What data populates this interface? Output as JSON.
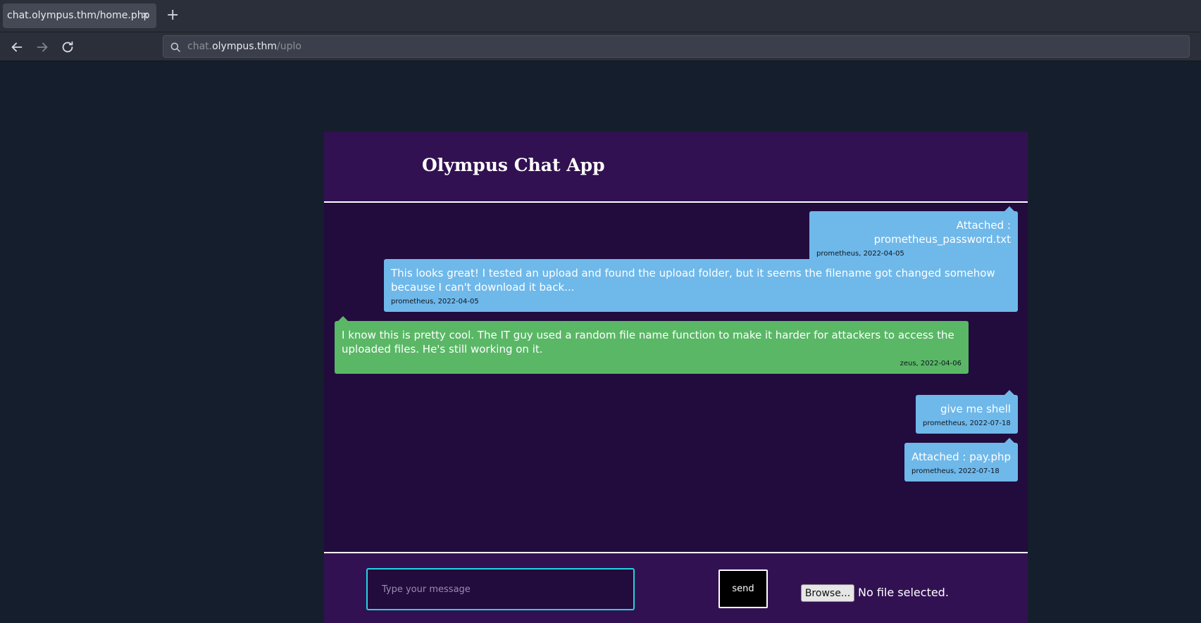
{
  "browser": {
    "tab_title": "chat.olympus.thm/home.php",
    "tab_close": "×",
    "new_tab": "+",
    "url_scheme_part": "chat.",
    "url_host": "olympus.thm",
    "url_path": "/uplo"
  },
  "app": {
    "title": "Olympus Chat App"
  },
  "messages": [
    {
      "text": "Attached : prometheus_password.txt",
      "meta": "prometheus, 2022-04-05",
      "side": "right",
      "color": "#6fb8ea"
    },
    {
      "text": "This looks great! I tested an upload and found the upload folder, but it seems the filename got changed somehow because I can't download it back...",
      "meta": "prometheus, 2022-04-05",
      "side": "right",
      "color": "#6fb8ea"
    },
    {
      "text": "I know this is pretty cool. The IT guy used a random file name function to make it harder for attackers to access the uploaded files. He's still working on it.",
      "meta": "zeus, 2022-04-06",
      "side": "left",
      "color": "#5ab766"
    },
    {
      "text": "give me shell",
      "meta": "prometheus, 2022-07-18",
      "side": "right",
      "color": "#6fb8ea"
    },
    {
      "text": "Attached : pay.php",
      "meta": "prometheus, 2022-07-18",
      "side": "right",
      "color": "#6fb8ea"
    }
  ],
  "composer": {
    "placeholder": "Type your message",
    "send_label": "send",
    "browse_label": "Browse...",
    "file_status": "No file selected."
  },
  "icons": {
    "back": "arrow-left-icon",
    "forward": "arrow-right-icon",
    "reload": "reload-icon",
    "search": "search-icon"
  },
  "colors": {
    "page_bg": "#151e2c",
    "app_header": "#321152",
    "chat_bg": "#220b3d",
    "bubble_blue": "#6fb8ea",
    "bubble_green": "#5ab766",
    "input_border": "#22d3e0"
  }
}
